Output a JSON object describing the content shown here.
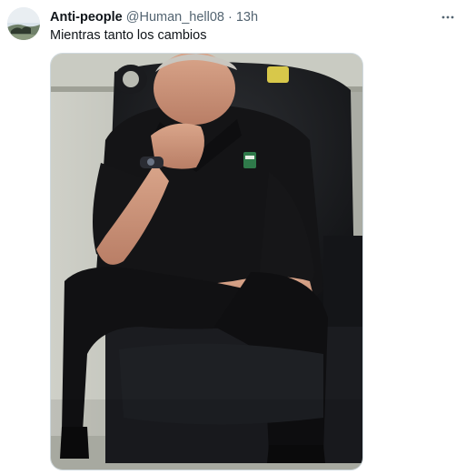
{
  "tweet": {
    "author": {
      "display_name": "Anti-people",
      "handle": "@Human_hell08"
    },
    "separator": "·",
    "time": "13h",
    "text": "Mientras tanto los cambios",
    "icons": {
      "avatar": "avatar-image",
      "more": "more-options-icon"
    },
    "media": {
      "description_icon": "photo-of-seated-man-in-black-shirt"
    }
  },
  "colors": {
    "text_primary": "#0f1419",
    "text_secondary": "#536471",
    "border": "#cfd9de"
  }
}
